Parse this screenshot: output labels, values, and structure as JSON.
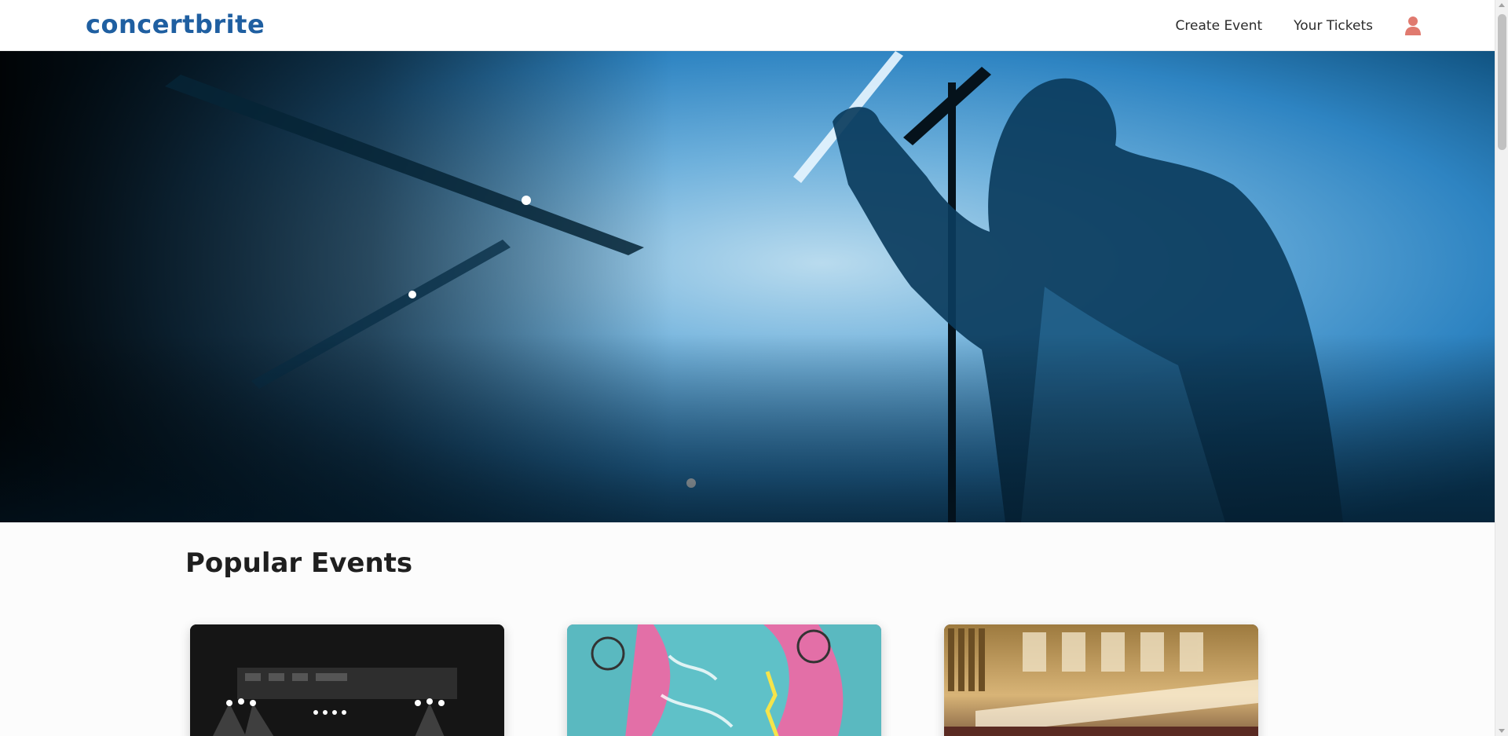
{
  "brand": {
    "name": "concertbrite",
    "color": "#1f5fa1"
  },
  "nav": {
    "create_event": "Create Event",
    "your_tickets": "Your Tickets",
    "user_icon": "user-icon",
    "user_icon_color": "#e07a6f"
  },
  "hero": {
    "image": "concert singer silhouette on stage in blue smoke"
  },
  "section": {
    "title": "Popular Events"
  },
  "events": [
    {
      "image": "stage lights concert"
    },
    {
      "image": "pink and teal dragon album art"
    },
    {
      "image": "concert hall with organ"
    }
  ]
}
